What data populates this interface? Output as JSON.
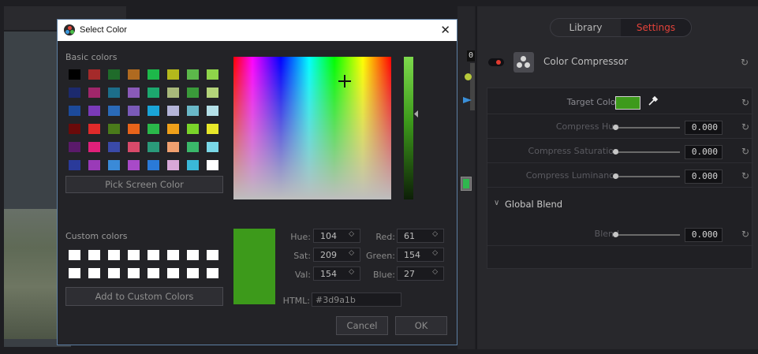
{
  "dialog": {
    "title": "Select Color",
    "basic_colors_label": "Basic colors",
    "basic_colors": [
      "#000000",
      "#a52a2a",
      "#1f6b2a",
      "#b06a20",
      "#1db84a",
      "#b4b81c",
      "#5cb84a",
      "#8fd44a",
      "#1c2a6e",
      "#a0266a",
      "#1c6e8a",
      "#8a5ab8",
      "#1ca86e",
      "#a8b87a",
      "#3a9a3a",
      "#b4d47a",
      "#1c4a9a",
      "#7a3ab8",
      "#2a6ab8",
      "#7a5ab8",
      "#1aa4d8",
      "#b4b4d8",
      "#6ab8c8",
      "#b4e0e8",
      "#6a0a0a",
      "#e02a2a",
      "#4a7a1a",
      "#e8641a",
      "#2ab84a",
      "#f0a01a",
      "#7ad42a",
      "#e8e82a",
      "#5a1a6a",
      "#e0207a",
      "#3a4aa8",
      "#d84a6a",
      "#2a9a7a",
      "#f0a070",
      "#3ab86a",
      "#7ad8e8",
      "#2a3a9a",
      "#9a3ab8",
      "#3a8ad8",
      "#a84ac8",
      "#2a7ad8",
      "#d8a8d8",
      "#3ab8d8",
      "#ffffff"
    ],
    "pick_screen_label": "Pick Screen Color",
    "custom_colors_label": "Custom colors",
    "custom_colors": [
      "#ffffff",
      "#ffffff",
      "#ffffff",
      "#ffffff",
      "#ffffff",
      "#ffffff",
      "#ffffff",
      "#ffffff",
      "#ffffff",
      "#ffffff",
      "#ffffff",
      "#ffffff",
      "#ffffff",
      "#ffffff",
      "#ffffff",
      "#ffffff"
    ],
    "add_custom_label": "Add to Custom Colors",
    "current_color": "#3d9a1b",
    "fields": {
      "hue_label": "Hue:",
      "hue": "104",
      "sat_label": "Sat:",
      "sat": "209",
      "val_label": "Val:",
      "val": "154",
      "red_label": "Red:",
      "red": "61",
      "green_label": "Green:",
      "green": "154",
      "blue_label": "Blue:",
      "blue": "27",
      "html_label": "HTML:",
      "html": "#3d9a1b"
    },
    "cancel_label": "Cancel",
    "ok_label": "OK",
    "close_glyph": "✕",
    "spin_glyph": "◇"
  },
  "inspector": {
    "tabs": [
      {
        "label": "Library",
        "active": false
      },
      {
        "label": "Settings",
        "active": true
      }
    ],
    "effect_title": "Color Compressor",
    "params": {
      "target_color_label": "Target Color",
      "target_color": "#3d9a1b",
      "compress_hue_label": "Compress Hue",
      "compress_hue": "0.000",
      "compress_saturation_label": "Compress Saturation",
      "compress_saturation": "0.000",
      "compress_luminance_label": "Compress Luminance",
      "compress_luminance": "0.000"
    },
    "global_blend_label": "Global Blend",
    "blend_label": "Blend",
    "blend": "0.000",
    "reset_glyph": "↻"
  },
  "node": {
    "index_label": "0"
  }
}
